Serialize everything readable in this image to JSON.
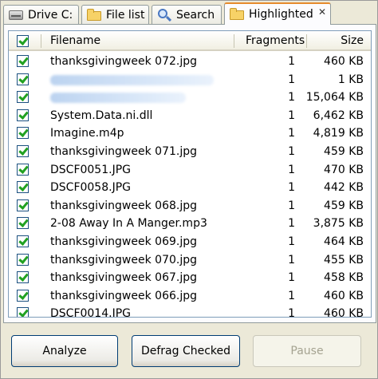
{
  "tabs": [
    {
      "label": "Drive C:",
      "icon": "drive-icon",
      "active": false
    },
    {
      "label": "File list",
      "icon": "folder-icon",
      "active": false
    },
    {
      "label": "Search",
      "icon": "search-icon",
      "active": false
    },
    {
      "label": "Highlighted",
      "icon": "folder-icon",
      "active": true
    }
  ],
  "tab_close_glyph": "✕",
  "table": {
    "columns": {
      "filename": "Filename",
      "fragments": "Fragments",
      "size": "Size"
    },
    "rows": [
      {
        "filename": "thanksgivingweek 072.jpg",
        "fragments": "1",
        "size": "460 KB",
        "checked": true
      },
      {
        "filename": "",
        "redacted": true,
        "fragments": "1",
        "size": "1 KB",
        "checked": true
      },
      {
        "filename": "",
        "redacted": true,
        "fragments": "1",
        "size": "15,064 KB",
        "checked": true
      },
      {
        "filename": "System.Data.ni.dll",
        "fragments": "1",
        "size": "6,462 KB",
        "checked": true
      },
      {
        "filename": "Imagine.m4p",
        "fragments": "1",
        "size": "4,819 KB",
        "checked": true
      },
      {
        "filename": "thanksgivingweek 071.jpg",
        "fragments": "1",
        "size": "459 KB",
        "checked": true
      },
      {
        "filename": "DSCF0051.JPG",
        "fragments": "1",
        "size": "470 KB",
        "checked": true
      },
      {
        "filename": "DSCF0058.JPG",
        "fragments": "1",
        "size": "442 KB",
        "checked": true
      },
      {
        "filename": "thanksgivingweek 068.jpg",
        "fragments": "1",
        "size": "459 KB",
        "checked": true
      },
      {
        "filename": "2-08 Away In A Manger.mp3",
        "fragments": "1",
        "size": "3,875 KB",
        "checked": true
      },
      {
        "filename": "thanksgivingweek 069.jpg",
        "fragments": "1",
        "size": "464 KB",
        "checked": true
      },
      {
        "filename": "thanksgivingweek 070.jpg",
        "fragments": "1",
        "size": "455 KB",
        "checked": true
      },
      {
        "filename": "thanksgivingweek 067.jpg",
        "fragments": "1",
        "size": "458 KB",
        "checked": true
      },
      {
        "filename": "thanksgivingweek 066.jpg",
        "fragments": "1",
        "size": "460 KB",
        "checked": true
      },
      {
        "filename": "DSCF0014.JPG",
        "fragments": "1",
        "size": "460 KB",
        "checked": true
      }
    ]
  },
  "buttons": {
    "analyze": "Analyze",
    "defrag_checked": "Defrag Checked",
    "pause": "Pause"
  },
  "colors": {
    "check": "#21a121",
    "active_tab_accent": "#e68b2c",
    "button_border": "#003c74"
  }
}
